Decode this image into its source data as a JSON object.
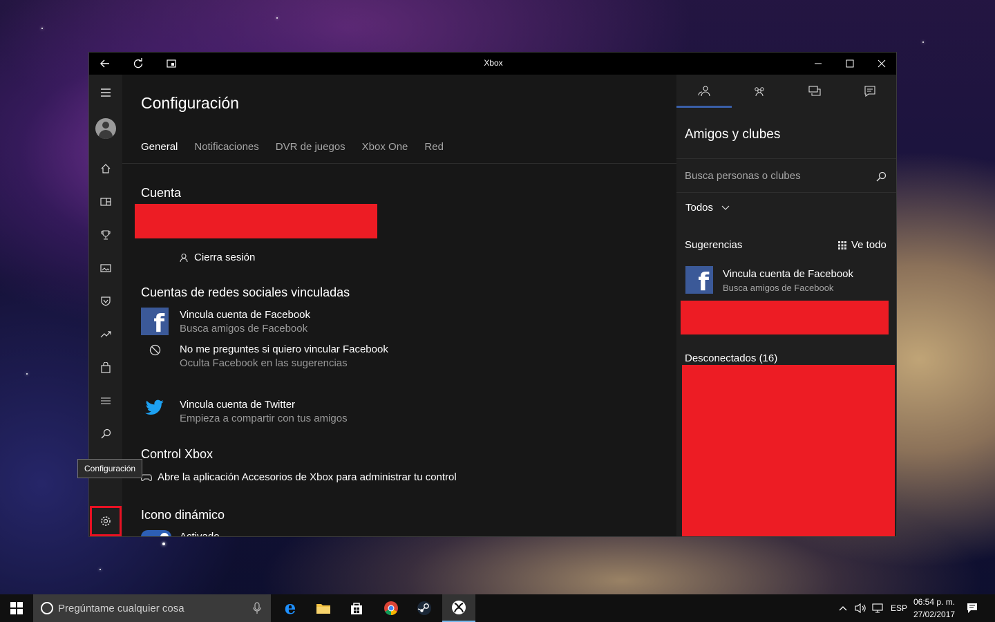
{
  "window": {
    "title": "Xbox"
  },
  "main": {
    "page_title": "Configuración",
    "tabs": [
      "General",
      "Notificaciones",
      "DVR de juegos",
      "Xbox One",
      "Red"
    ],
    "account": {
      "heading": "Cuenta",
      "sign_out": "Cierra sesión"
    },
    "social": {
      "heading": "Cuentas de redes sociales vinculadas",
      "facebook_title": "Vincula cuenta de Facebook",
      "facebook_sub": "Busca amigos de Facebook",
      "no_ask_title": "No me preguntes si quiero vincular Facebook",
      "no_ask_sub": "Oculta Facebook en las sugerencias",
      "twitter_title": "Vincula cuenta de Twitter",
      "twitter_sub": "Empieza a compartir con tus amigos"
    },
    "controller": {
      "heading": "Control Xbox",
      "text": "Abre la aplicación Accesorios de Xbox para administrar tu control"
    },
    "live_tile": {
      "heading": "Icono dinámico",
      "state": "Activado"
    }
  },
  "rail": {
    "tooltip": "Configuración"
  },
  "pane": {
    "title": "Amigos y clubes",
    "search_placeholder": "Busca personas o clubes",
    "filter": "Todos",
    "suggestions": "Sugerencias",
    "see_all": "Ve todo",
    "fb_title": "Vincula cuenta de Facebook",
    "fb_sub": "Busca amigos de Facebook",
    "offline": "Desconectados (16)"
  },
  "taskbar": {
    "search_placeholder": "Pregúntame cualquier cosa",
    "lang": "ESP",
    "time": "06:54 p. m.",
    "date": "27/02/2017"
  },
  "colors": {
    "accent": "#3a5fa8",
    "redaction": "#ed1c24",
    "highlight_box": "#e81123",
    "facebook": "#3b5998",
    "twitter": "#1da1f2"
  }
}
